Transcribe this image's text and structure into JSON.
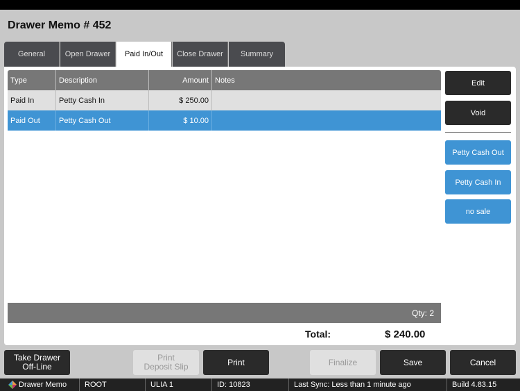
{
  "title": "Drawer Memo # 452",
  "tabs": [
    "General",
    "Open Drawer",
    "Paid In/Out",
    "Close Drawer",
    "Summary"
  ],
  "table": {
    "headers": [
      "Type",
      "Description",
      "Amount",
      "Notes"
    ],
    "rows": [
      [
        "Paid In",
        "Petty Cash In",
        "$ 250.00",
        ""
      ],
      [
        "Paid Out",
        "Petty Cash Out",
        "$ 10.00",
        ""
      ]
    ]
  },
  "side": {
    "edit": "Edit",
    "void": "Void",
    "quick": [
      "Petty Cash Out",
      "Petty Cash In",
      "no sale"
    ]
  },
  "qty": "Qty:  2",
  "total": {
    "label": "Total:",
    "value": "$ 240.00"
  },
  "buttons": {
    "offline": "Take Drawer Off-Line",
    "deposit": "Print Deposit Slip",
    "print": "Print",
    "finalize": "Finalize",
    "save": "Save",
    "cancel": "Cancel"
  },
  "status": {
    "app": "Drawer Memo",
    "user": "ROOT",
    "station": "ULIA 1",
    "id": "ID: 10823",
    "sync": "Last Sync: Less than 1 minute ago",
    "build": "Build 4.83.15"
  }
}
